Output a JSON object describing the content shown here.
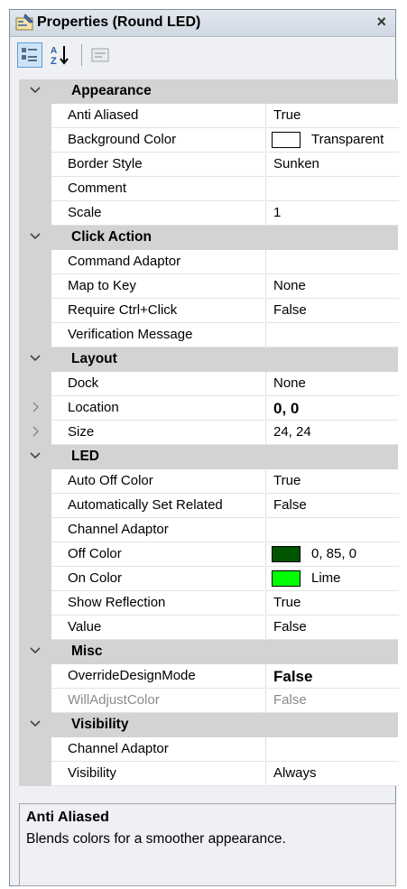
{
  "window": {
    "title": "Properties (Round LED)",
    "close": "×"
  },
  "toolbar": {
    "buttons": [
      {
        "icon": "categorized-icon",
        "active": true
      },
      {
        "icon": "alphabetical-sort-icon",
        "active": false
      },
      {
        "icon": "property-pages-icon",
        "active": false
      }
    ]
  },
  "categories": [
    {
      "label": "Appearance",
      "props": [
        {
          "name": "Anti Aliased",
          "value": "True"
        },
        {
          "name": "Background Color",
          "value": "Transparent",
          "swatch": "#ffffff"
        },
        {
          "name": "Border Style",
          "value": "Sunken"
        },
        {
          "name": "Comment",
          "value": ""
        },
        {
          "name": "Scale",
          "value": "1"
        }
      ]
    },
    {
      "label": "Click Action",
      "props": [
        {
          "name": "Command Adaptor",
          "value": ""
        },
        {
          "name": "Map to Key",
          "value": "None"
        },
        {
          "name": "Require Ctrl+Click",
          "value": "False"
        },
        {
          "name": "Verification Message",
          "value": ""
        }
      ]
    },
    {
      "label": "Layout",
      "props": [
        {
          "name": "Dock",
          "value": "None"
        },
        {
          "name": "Location",
          "value": "0, 0",
          "expandable": true,
          "bold": true
        },
        {
          "name": "Size",
          "value": "24, 24",
          "expandable": true
        }
      ]
    },
    {
      "label": "LED",
      "props": [
        {
          "name": "Auto Off Color",
          "value": "True"
        },
        {
          "name": "Automatically Set Related",
          "value": "False"
        },
        {
          "name": "Channel Adaptor",
          "value": ""
        },
        {
          "name": "Off Color",
          "value": "0, 85, 0",
          "swatch": "#005500"
        },
        {
          "name": "On Color",
          "value": "Lime",
          "swatch": "#00ff00"
        },
        {
          "name": "Show Reflection",
          "value": "True"
        },
        {
          "name": "Value",
          "value": "False"
        }
      ]
    },
    {
      "label": "Misc",
      "props": [
        {
          "name": "OverrideDesignMode",
          "value": "False",
          "bold": true
        },
        {
          "name": "WillAdjustColor",
          "value": "False",
          "disabled": true
        }
      ]
    },
    {
      "label": "Visibility",
      "props": [
        {
          "name": "Channel Adaptor",
          "value": ""
        },
        {
          "name": "Visibility",
          "value": "Always"
        }
      ]
    }
  ],
  "description": {
    "title": "Anti Aliased",
    "text": "Blends colors for a smoother appearance."
  }
}
